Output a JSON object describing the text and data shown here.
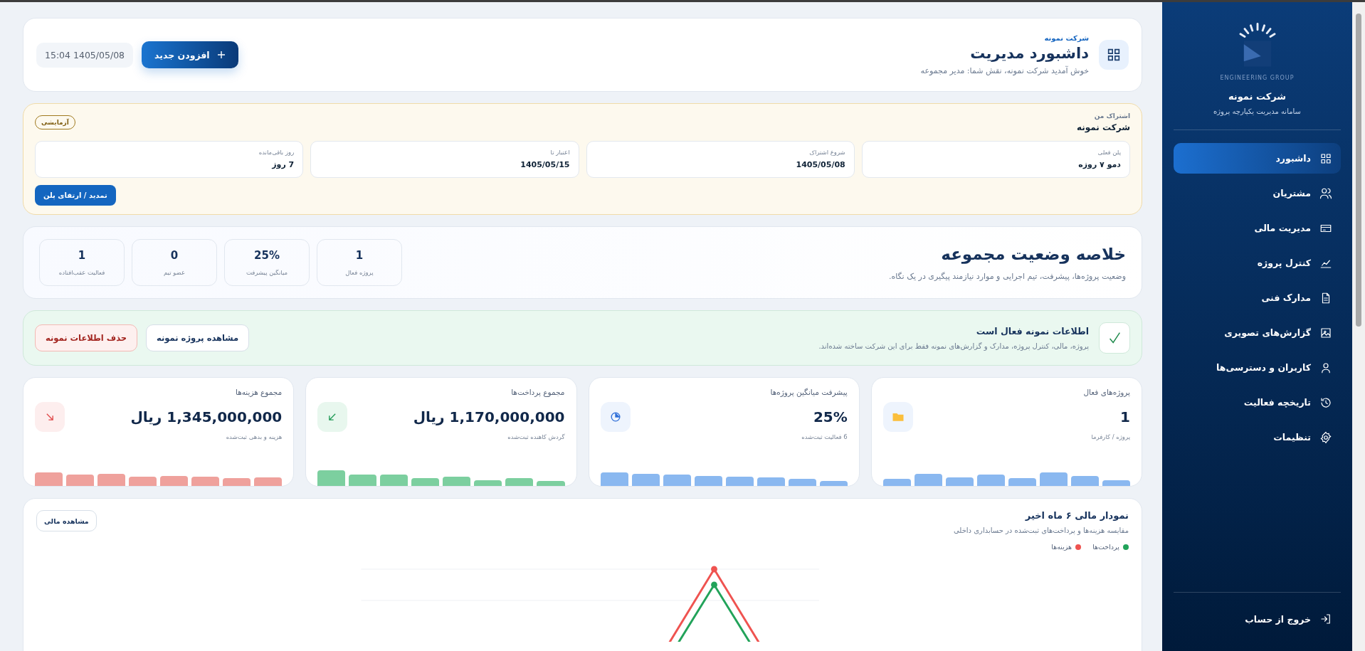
{
  "sidebar": {
    "logo_caption": "ENGINEERING GROUP",
    "company": "شرکت نمونه",
    "tagline": "سامانه مدیریت یکپارچه پروژه",
    "items": [
      {
        "label": "داشبورد",
        "selected": true
      },
      {
        "label": "مشتریان",
        "selected": false
      },
      {
        "label": "مدیریت مالی",
        "selected": false
      },
      {
        "label": "کنترل پروژه",
        "selected": false
      },
      {
        "label": "مدارک فنی",
        "selected": false
      },
      {
        "label": "گزارش‌های تصویری",
        "selected": false
      },
      {
        "label": "کاربران و دسترسی‌ها",
        "selected": false
      },
      {
        "label": "تاریخچه فعالیت",
        "selected": false
      },
      {
        "label": "تنظیمات",
        "selected": false
      }
    ],
    "logout": "خروج از حساب"
  },
  "header": {
    "company": "شرکت نمونه",
    "title": "داشبورد مدیریت",
    "welcome": "خوش آمدید شرکت نمونه، نقش شما: مدیر مجموعه",
    "add_button": "افزودن جدید",
    "datetime": "15:04 1405/05/08"
  },
  "subscription": {
    "label": "اشتراک من",
    "company": "شرکت نمونه",
    "badge": "آزمایشی",
    "fields": [
      {
        "label": "پلن فعلی",
        "value": "دمو ۷ روزه"
      },
      {
        "label": "شروع اشتراک",
        "value": "1405/05/08"
      },
      {
        "label": "اعتبار تا",
        "value": "1405/05/15"
      },
      {
        "label": "روز باقی‌مانده",
        "value": "7 روز"
      }
    ],
    "renew_button": "تمدید / ارتقای پلن"
  },
  "summary": {
    "title": "خلاصه وضعیت مجموعه",
    "subtitle": "وضعیت پروژه‌ها، پیشرفت، تیم اجرایی و موارد نیازمند پیگیری در یک نگاه.",
    "tiles": [
      {
        "value": "1",
        "label": "پروژه فعال"
      },
      {
        "value": "25%",
        "label": "میانگین پیشرفت"
      },
      {
        "value": "0",
        "label": "عضو تیم"
      },
      {
        "value": "1",
        "label": "فعالیت عقب‌افتاده"
      }
    ]
  },
  "sample_notice": {
    "title": "اطلاعات نمونه فعال است",
    "text": "پروژه، مالی، کنترل پروژه، مدارک و گزارش‌های نمونه فقط برای این شرکت ساخته شده‌اند.",
    "view_button": "مشاهده پروژه نمونه",
    "delete_button": "حذف اطلاعات نمونه"
  },
  "stat_cards": [
    {
      "title": "پروژه‌های فعال",
      "value": "1",
      "note": "پروژه / کارفرما",
      "color": "#8ab8f0"
    },
    {
      "title": "پیشرفت میانگین پروژه‌ها",
      "value": "25%",
      "note": "6 فعالیت ثبت‌شده",
      "color": "#8ab8f0"
    },
    {
      "title": "مجموع پرداخت‌ها",
      "value": "1,170,000,000 ریال",
      "note": "گردش کاهنده ثبت‌شده",
      "color": "#7ccf9f"
    },
    {
      "title": "مجموع هزینه‌ها",
      "value": "1,345,000,000 ریال",
      "note": "هزینه و بدهی ثبت‌شده",
      "color": "#efa19c"
    }
  ],
  "finance_chart": {
    "title": "نمودار مالی ۶ ماه اخیر",
    "subtitle": "مقایسه هزینه‌ها و پرداخت‌های ثبت‌شده در حسابداری داخلی",
    "button": "مشاهده مالی",
    "legend": [
      {
        "label": "پرداخت‌ها",
        "color": "#22a35a"
      },
      {
        "label": "هزینه‌ها",
        "color": "#ef5350"
      }
    ]
  }
}
